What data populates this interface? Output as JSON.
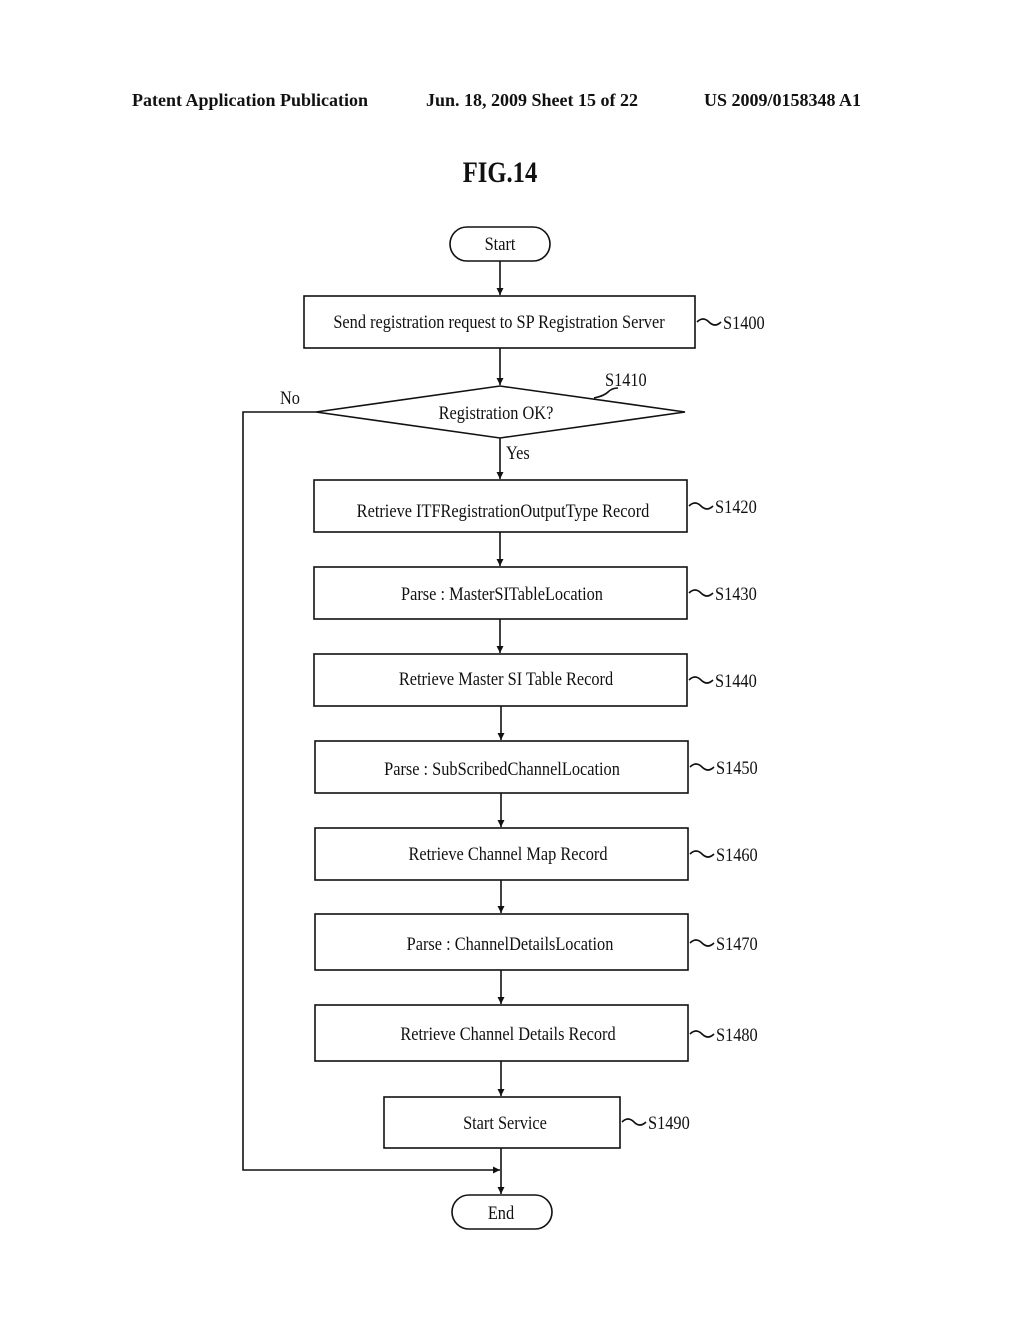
{
  "header": {
    "left": "Patent Application Publication",
    "middle": "Jun. 18, 2009  Sheet 15 of 22",
    "right": "US 2009/0158348 A1"
  },
  "figure": {
    "title": "FIG.14"
  },
  "flow": {
    "start": "Start",
    "end": "End",
    "decision": {
      "text": "Registration OK?",
      "label": "S1410",
      "yes": "Yes",
      "no": "No"
    },
    "steps": [
      {
        "id": "S1400",
        "text": "Send registration request to SP Registration Server"
      },
      {
        "id": "S1420",
        "text": "Retrieve ITFRegistrationOutputType Record"
      },
      {
        "id": "S1430",
        "text": "Parse : MasterSITableLocation"
      },
      {
        "id": "S1440",
        "text": "Retrieve Master SI Table Record"
      },
      {
        "id": "S1450",
        "text": "Parse : SubScribedChannelLocation"
      },
      {
        "id": "S1460",
        "text": "Retrieve Channel Map Record"
      },
      {
        "id": "S1470",
        "text": "Parse : ChannelDetailsLocation"
      },
      {
        "id": "S1480",
        "text": "Retrieve Channel Details Record"
      },
      {
        "id": "S1490",
        "text": "Start Service"
      }
    ]
  }
}
